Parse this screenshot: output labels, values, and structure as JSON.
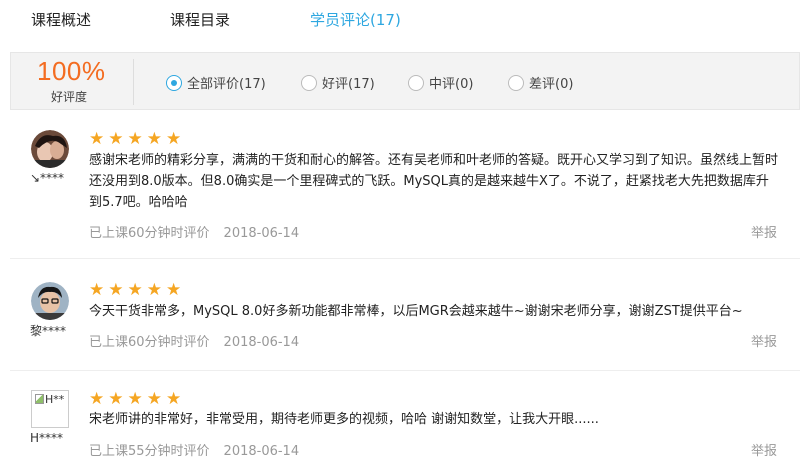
{
  "tabs": [
    {
      "label": "课程概述"
    },
    {
      "label": "课程目录"
    },
    {
      "label": "学员评论(17)"
    }
  ],
  "summary": {
    "rate": "100%",
    "rate_label": "好评度",
    "filters": [
      {
        "label": "全部评价(17)",
        "selected": true
      },
      {
        "label": "好评(17)",
        "selected": false
      },
      {
        "label": "中评(0)",
        "selected": false
      },
      {
        "label": "差评(0)",
        "selected": false
      }
    ]
  },
  "reviews": [
    {
      "username": "↘****",
      "stars": "★★★★★",
      "text": "感谢宋老师的精彩分享，满满的干货和耐心的解答。还有吴老师和叶老师的答疑。既开心又学习到了知识。虽然线上暂时还没用到8.0版本。但8.0确实是一个里程碑式的飞跃。MySQL真的是越来越牛X了。不说了，赶紧找老大先把数据库升到5.7吧。哈哈哈",
      "meta": "已上课60分钟时评价",
      "date": "2018-06-14",
      "report": "举报"
    },
    {
      "username": "黎****",
      "stars": "★★★★★",
      "text": "今天干货非常多，MySQL 8.0好多新功能都非常棒，以后MGR会越来越牛~谢谢宋老师分享，谢谢ZST提供平台~",
      "meta": "已上课60分钟时评价",
      "date": "2018-06-14",
      "report": "举报"
    },
    {
      "username": "H****",
      "avatar_alt": "H**",
      "stars": "★★★★★",
      "text": "宋老师讲的非常好，非常受用，期待老师更多的视频，哈哈 谢谢知数堂，让我大开眼......",
      "meta": "已上课55分钟时评价",
      "date": "2018-06-14",
      "report": "举报"
    }
  ],
  "colors": {
    "accent": "#2ea7e0",
    "rate": "#f36c21",
    "star": "#f5a623"
  }
}
